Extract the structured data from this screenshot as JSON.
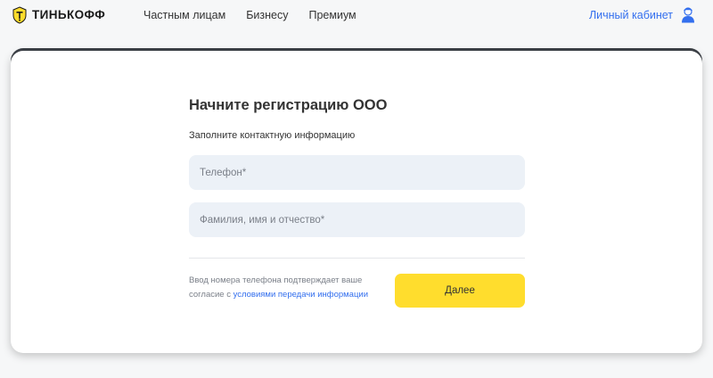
{
  "header": {
    "logo_text": "ТИНЬКОФФ",
    "nav": [
      {
        "label": "Частным лицам"
      },
      {
        "label": "Бизнесу"
      },
      {
        "label": "Премиум"
      }
    ],
    "account_label": "Личный кабинет",
    "account_icon": "user-icon"
  },
  "form": {
    "title": "Начните регистрацию ООО",
    "subtitle": "Заполните контактную информацию",
    "phone_placeholder": "Телефон*",
    "name_placeholder": "Фамилия, имя и отчество*",
    "consent_prefix": "Ввод номера телефона подтверждает ваше согласие с ",
    "consent_link": "условиями передачи информации",
    "submit_label": "Далее"
  },
  "colors": {
    "accent_yellow": "#ffdd2d",
    "link_blue": "#336fee",
    "field_bg": "#ecf1f7",
    "page_bg": "#f6f7f8"
  }
}
